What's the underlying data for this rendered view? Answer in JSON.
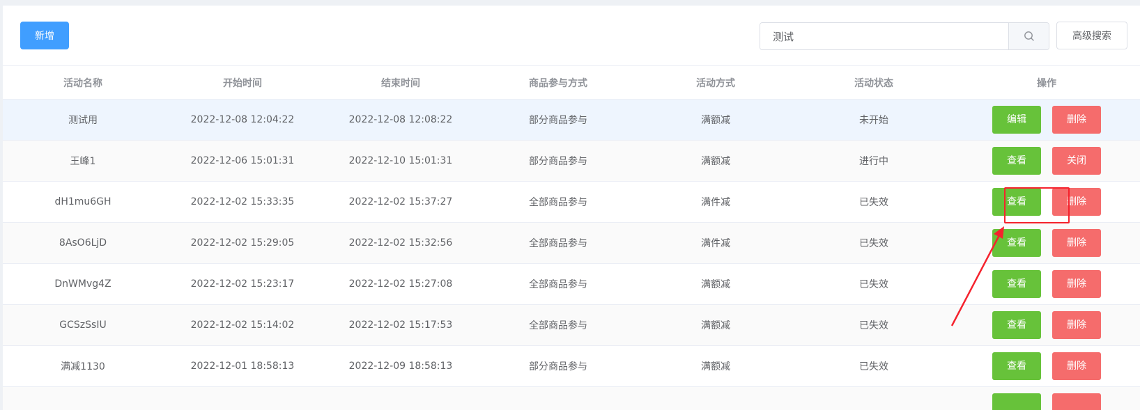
{
  "toolbar": {
    "add_label": "新增",
    "search_value": "测试",
    "advanced_search_label": "高级搜索"
  },
  "table": {
    "columns": [
      "活动名称",
      "开始时间",
      "结束时间",
      "商品参与方式",
      "活动方式",
      "活动状态",
      "操作"
    ],
    "rows": [
      {
        "name": "测试用",
        "start": "2022-12-08 12:04:22",
        "end": "2022-12-08 12:08:22",
        "mode": "部分商品参与",
        "type": "满额减",
        "status": "未开始",
        "action1": "编辑",
        "action2": "删除"
      },
      {
        "name": "王峰1",
        "start": "2022-12-06 15:01:31",
        "end": "2022-12-10 15:01:31",
        "mode": "部分商品参与",
        "type": "满额减",
        "status": "进行中",
        "action1": "查看",
        "action2": "关闭"
      },
      {
        "name": "dH1mu6GH",
        "start": "2022-12-02 15:33:35",
        "end": "2022-12-02 15:37:27",
        "mode": "全部商品参与",
        "type": "满件减",
        "status": "已失效",
        "action1": "查看",
        "action2": "删除"
      },
      {
        "name": "8AsO6LjD",
        "start": "2022-12-02 15:29:05",
        "end": "2022-12-02 15:32:56",
        "mode": "全部商品参与",
        "type": "满件减",
        "status": "已失效",
        "action1": "查看",
        "action2": "删除"
      },
      {
        "name": "DnWMvg4Z",
        "start": "2022-12-02 15:23:17",
        "end": "2022-12-02 15:27:08",
        "mode": "全部商品参与",
        "type": "满额减",
        "status": "已失效",
        "action1": "查看",
        "action2": "删除"
      },
      {
        "name": "GCSzSsIU",
        "start": "2022-12-02 15:14:02",
        "end": "2022-12-02 15:17:53",
        "mode": "全部商品参与",
        "type": "满额减",
        "status": "已失效",
        "action1": "查看",
        "action2": "删除"
      },
      {
        "name": "满减1130",
        "start": "2022-12-01 18:58:13",
        "end": "2022-12-09 18:58:13",
        "mode": "部分商品参与",
        "type": "满额减",
        "status": "已失效",
        "action1": "查看",
        "action2": "删除"
      },
      {
        "name": "",
        "start": "",
        "end": "",
        "mode": "",
        "type": "",
        "status": "",
        "action1": "",
        "action2": ""
      }
    ]
  },
  "colors": {
    "primary": "#409eff",
    "success": "#67c23a",
    "danger": "#f56c6c",
    "annotation": "#f5222d"
  }
}
